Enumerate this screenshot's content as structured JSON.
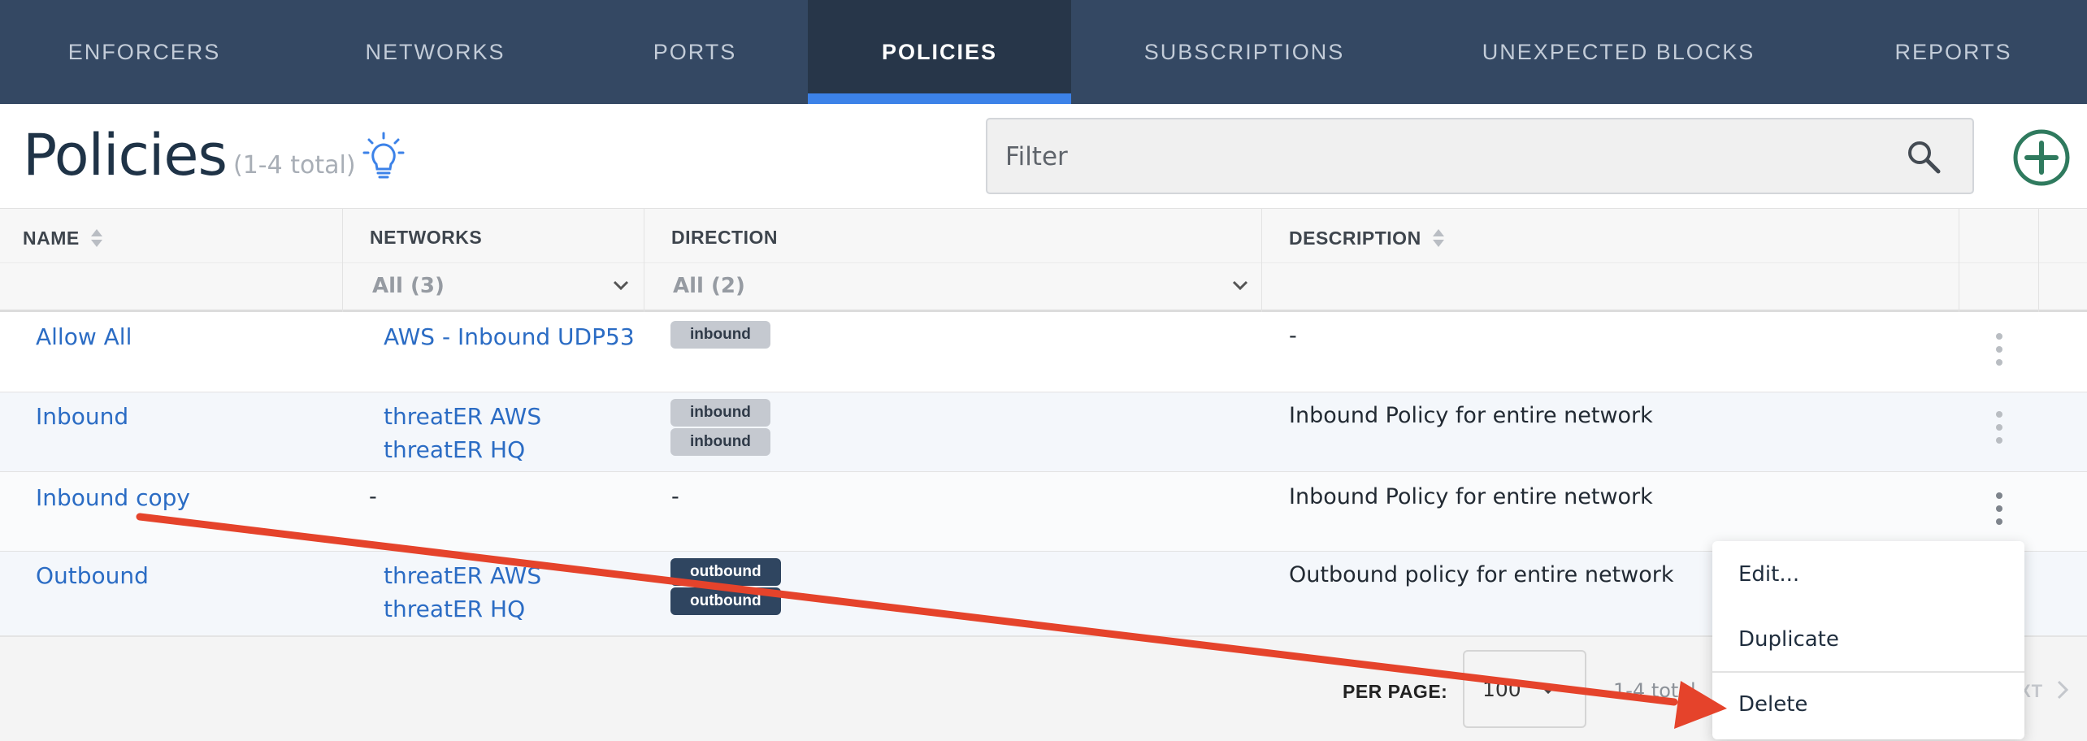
{
  "nav": {
    "items": [
      {
        "label": "ENFORCERS"
      },
      {
        "label": "NETWORKS"
      },
      {
        "label": "PORTS"
      },
      {
        "label": "POLICIES"
      },
      {
        "label": "SUBSCRIPTIONS"
      },
      {
        "label": "UNEXPECTED BLOCKS"
      },
      {
        "label": "REPORTS"
      }
    ],
    "active": "POLICIES"
  },
  "header": {
    "title": "Policies",
    "count": "(1-4 total)",
    "filter_placeholder": "Filter"
  },
  "table": {
    "columns": {
      "name": "NAME",
      "networks": "NETWORKS",
      "direction": "DIRECTION",
      "description": "DESCRIPTION"
    },
    "filters": {
      "networks": "All (3)",
      "direction": "All (2)"
    },
    "rows": [
      {
        "name": "Allow All",
        "networks": [
          "AWS - Inbound UDP53"
        ],
        "directions": [
          "inbound"
        ],
        "description": "-"
      },
      {
        "name": "Inbound",
        "networks": [
          "threatER AWS",
          "threatER HQ"
        ],
        "directions": [
          "inbound",
          "inbound"
        ],
        "description": "Inbound Policy for entire network"
      },
      {
        "name": "Inbound copy",
        "networks": [
          "-"
        ],
        "directions": [
          "-"
        ],
        "description": "Inbound Policy for entire network"
      },
      {
        "name": "Outbound",
        "networks": [
          "threatER AWS",
          "threatER HQ"
        ],
        "directions": [
          "outbound",
          "outbound"
        ],
        "description": "Outbound policy for entire network"
      }
    ]
  },
  "footer": {
    "per_page_label": "PER PAGE:",
    "per_page_value": "100",
    "total": "1-4 total",
    "next": "XT"
  },
  "menu": {
    "items": [
      "Edit...",
      "Duplicate",
      "Delete"
    ]
  },
  "colors": {
    "nav_bg": "#344863",
    "nav_active_bg": "#273649",
    "nav_active_underline": "#3c82e8",
    "link": "#2b6cc4",
    "add_button": "#2f7a5e",
    "annotation_arrow": "#e5432b"
  }
}
